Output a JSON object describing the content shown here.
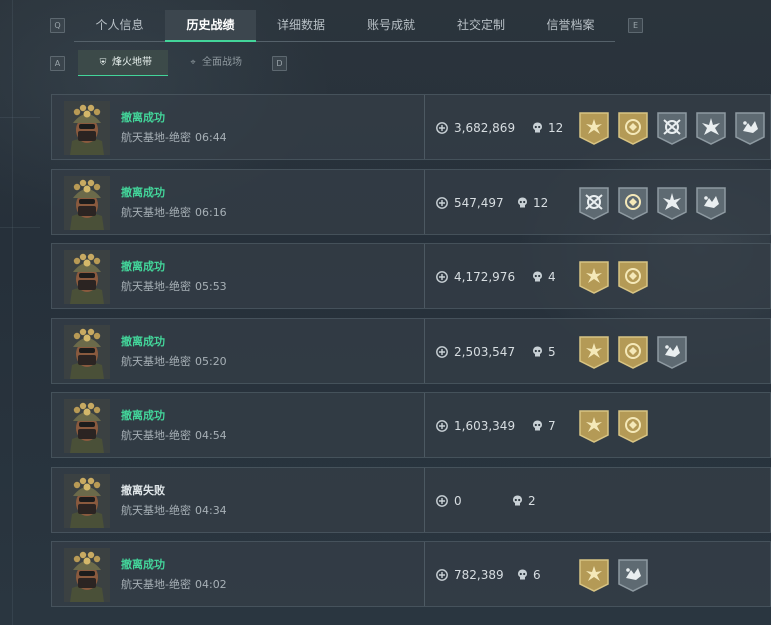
{
  "keys": {
    "left": "Q",
    "right": "E",
    "sub_left": "A",
    "sub_right": "D"
  },
  "tabs": [
    {
      "label": "个人信息",
      "active": false
    },
    {
      "label": "历史战绩",
      "active": true
    },
    {
      "label": "详细数据",
      "active": false
    },
    {
      "label": "账号成就",
      "active": false
    },
    {
      "label": "社交定制",
      "active": false
    },
    {
      "label": "信誉档案",
      "active": false
    }
  ],
  "subtabs": [
    {
      "label": "烽火地带",
      "icon": "shield-icon",
      "active": true
    },
    {
      "label": "全面战场",
      "icon": "crosshair-icon",
      "active": false
    }
  ],
  "colors": {
    "accent": "#43d59a",
    "gold_badge": "#b49a56",
    "gray_badge": "#5e6a72"
  },
  "matches": [
    {
      "status": "撤离成功",
      "success": true,
      "map": "航天基地-绝密",
      "time": "06:44",
      "value": "3,682,869",
      "kills": "12",
      "badges": [
        {
          "type": "gold",
          "icon": "star-burst-icon"
        },
        {
          "type": "gold",
          "icon": "coin-emblem-icon"
        },
        {
          "type": "gray",
          "icon": "crossed-rifles-icon"
        },
        {
          "type": "gray",
          "icon": "shatter-star-icon"
        },
        {
          "type": "gray",
          "icon": "explosion-icon"
        }
      ]
    },
    {
      "status": "撤离成功",
      "success": true,
      "map": "航天基地-绝密",
      "time": "06:16",
      "value": "547,497",
      "kills": "12",
      "badges": [
        {
          "type": "gray",
          "icon": "crossed-rifles-icon"
        },
        {
          "type": "gray",
          "icon": "coin-emblem-icon"
        },
        {
          "type": "gray",
          "icon": "shatter-star-icon"
        },
        {
          "type": "gray",
          "icon": "explosion-icon"
        }
      ]
    },
    {
      "status": "撤离成功",
      "success": true,
      "map": "航天基地-绝密",
      "time": "05:53",
      "value": "4,172,976",
      "kills": "4",
      "badges": [
        {
          "type": "gold",
          "icon": "star-burst-icon"
        },
        {
          "type": "gold",
          "icon": "coin-emblem-icon"
        }
      ]
    },
    {
      "status": "撤离成功",
      "success": true,
      "map": "航天基地-绝密",
      "time": "05:20",
      "value": "2,503,547",
      "kills": "5",
      "badges": [
        {
          "type": "gold",
          "icon": "star-burst-icon"
        },
        {
          "type": "gold",
          "icon": "coin-emblem-icon"
        },
        {
          "type": "gray",
          "icon": "explosion-icon"
        }
      ]
    },
    {
      "status": "撤离成功",
      "success": true,
      "map": "航天基地-绝密",
      "time": "04:54",
      "value": "1,603,349",
      "kills": "7",
      "badges": [
        {
          "type": "gold",
          "icon": "star-burst-icon"
        },
        {
          "type": "gold",
          "icon": "coin-emblem-icon"
        }
      ]
    },
    {
      "status": "撤离失败",
      "success": false,
      "map": "航天基地-绝密",
      "time": "04:34",
      "value": "0",
      "kills": "2",
      "badges": []
    },
    {
      "status": "撤离成功",
      "success": true,
      "map": "航天基地-绝密",
      "time": "04:02",
      "value": "782,389",
      "kills": "6",
      "badges": [
        {
          "type": "gold",
          "icon": "star-burst-icon"
        },
        {
          "type": "gray",
          "icon": "explosion-icon"
        }
      ]
    }
  ]
}
